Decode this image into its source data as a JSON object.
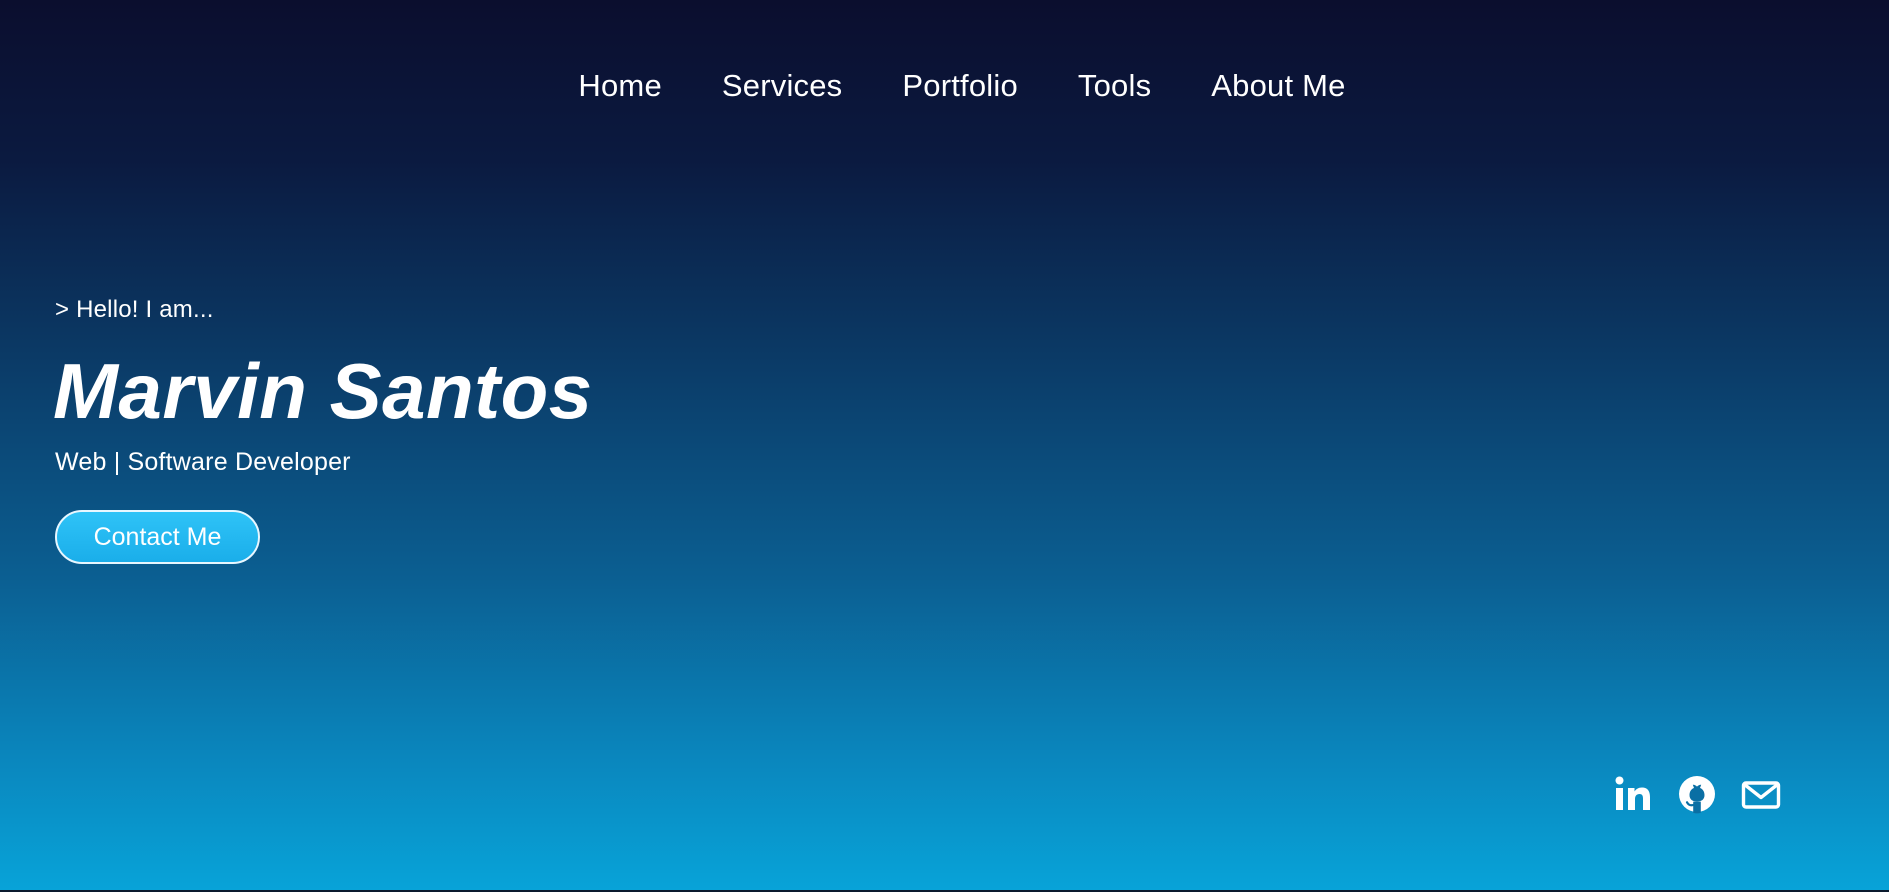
{
  "nav": {
    "items": [
      {
        "label": "Home"
      },
      {
        "label": "Services"
      },
      {
        "label": "Portfolio"
      },
      {
        "label": "Tools"
      },
      {
        "label": "About Me"
      }
    ]
  },
  "hero": {
    "intro": "> Hello! I am...",
    "name": "Marvin Santos",
    "role": "Web | Software Developer",
    "cta_label": "Contact Me"
  },
  "socials": [
    {
      "icon": "linkedin-icon"
    },
    {
      "icon": "github-icon"
    },
    {
      "icon": "mail-icon"
    }
  ],
  "colors": {
    "gradient_top": "#0b0e2e",
    "gradient_bottom": "#08a3d8",
    "button_bg": "#2fc3f7",
    "text": "#ffffff"
  }
}
